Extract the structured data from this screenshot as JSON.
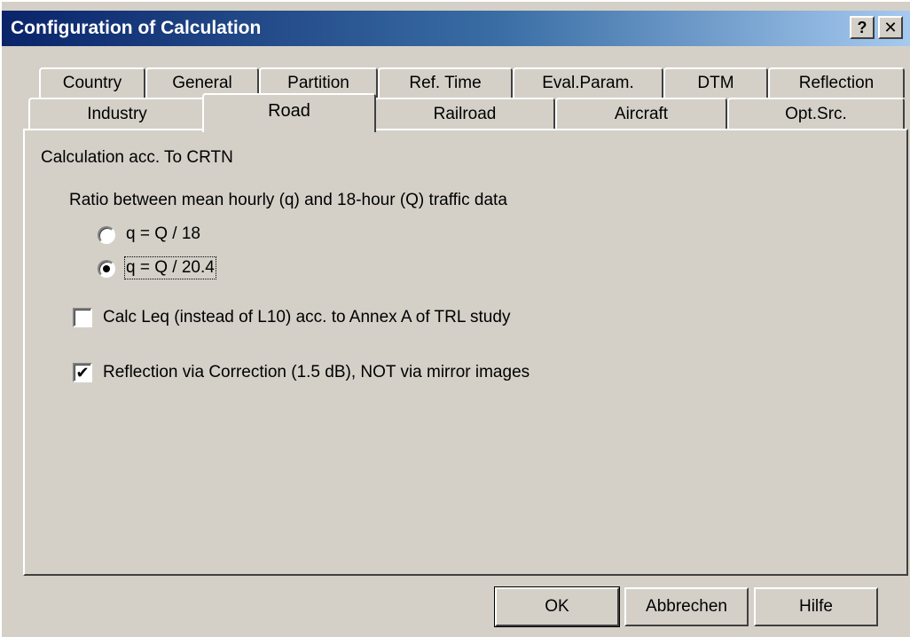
{
  "window": {
    "title": "Configuration of Calculation",
    "help_button": "?",
    "close_button": "✕"
  },
  "tabs_row1": [
    {
      "label": "Country"
    },
    {
      "label": "General"
    },
    {
      "label": "Partition"
    },
    {
      "label": "Ref. Time"
    },
    {
      "label": "Eval.Param."
    },
    {
      "label": "DTM"
    },
    {
      "label": "Reflection"
    }
  ],
  "tabs_row2": [
    {
      "label": "Industry"
    },
    {
      "label": "Road",
      "active": true
    },
    {
      "label": "Railroad"
    },
    {
      "label": "Aircraft"
    },
    {
      "label": "Opt.Src."
    }
  ],
  "panel": {
    "heading": "Calculation acc. To CRTN",
    "ratio_label": "Ratio between mean hourly (q) and 18-hour (Q) traffic data",
    "radio_options": [
      {
        "label": "q = Q / 18",
        "checked": false
      },
      {
        "label": "q = Q / 20.4",
        "checked": true
      }
    ],
    "checkboxes": [
      {
        "label": "Calc Leq (instead of L10) acc. to Annex A of TRL study",
        "checked": false
      },
      {
        "label": "Reflection via Correction (1.5 dB), NOT via mirror images",
        "checked": true
      }
    ],
    "check_mark": "✔"
  },
  "buttons": {
    "ok": "OK",
    "cancel": "Abbrechen",
    "help": "Hilfe"
  }
}
